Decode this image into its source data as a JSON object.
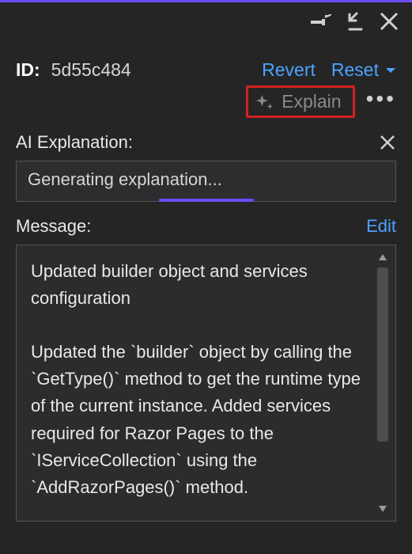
{
  "header": {
    "id_label": "ID:",
    "id_value": "5d55c484",
    "revert": "Revert",
    "reset": "Reset",
    "explain": "Explain"
  },
  "ai": {
    "section_label": "AI Explanation:",
    "generating": "Generating explanation..."
  },
  "message": {
    "section_label": "Message:",
    "edit": "Edit",
    "body": "Updated builder object and services configuration\n\nUpdated the `builder` object by calling the `GetType()` method to get the runtime type of the current instance. Added services required for Razor Pages to the `IServiceCollection` using the `AddRazorPages()` method."
  }
}
